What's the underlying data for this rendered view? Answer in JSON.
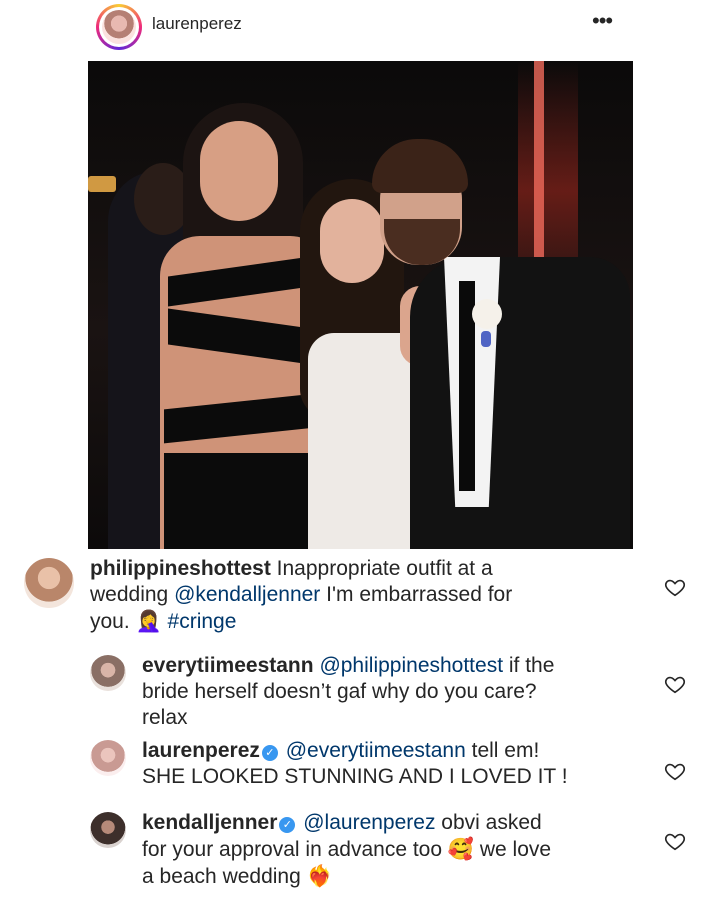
{
  "post": {
    "username": "laurenperez",
    "more_label": "•••"
  },
  "comments": [
    {
      "username": "philippineshottest",
      "lines": [
        {
          "before": "Inappropriate outfit at a"
        },
        {
          "before": "wedding ",
          "mention": "@kendalljenner",
          "after": " I'm embarrassed for"
        },
        {
          "before": "you. ",
          "emoji": "🤦‍♀️",
          "hashtag": "#cringe"
        }
      ],
      "avatar_color": "#b9866a"
    },
    {
      "username": "everytiimeestann",
      "lines": [
        {
          "mention": "@philippineshottest",
          "after": " if the"
        },
        {
          "before": "bride herself doesn’t gaf why do you care?"
        },
        {
          "before": "relax"
        }
      ],
      "avatar_color": "#8a6f65"
    },
    {
      "username": "laurenperez",
      "verified": true,
      "lines": [
        {
          "mention": "@everytiimeestann",
          "after": " tell em!"
        },
        {
          "before": "SHE LOOKED STUNNING AND I LOVED IT !"
        }
      ],
      "avatar_color": "#c99a93"
    },
    {
      "username": "kendalljenner",
      "verified": true,
      "lines": [
        {
          "mention": "@laurenperez",
          "after": " obvi asked"
        },
        {
          "before": "for your approval in advance too ",
          "emoji": "🥰",
          "after": " we love"
        },
        {
          "before": "a beach wedding ",
          "emoji": "❤️‍🔥"
        }
      ],
      "avatar_color": "#3d2f2b"
    }
  ],
  "icons": {
    "like": "heart-outline-icon",
    "verified": "verified-badge-icon",
    "more": "more-horizontal-icon"
  },
  "colors": {
    "text": "#262626",
    "link": "#00376b",
    "verified": "#3897f0"
  }
}
